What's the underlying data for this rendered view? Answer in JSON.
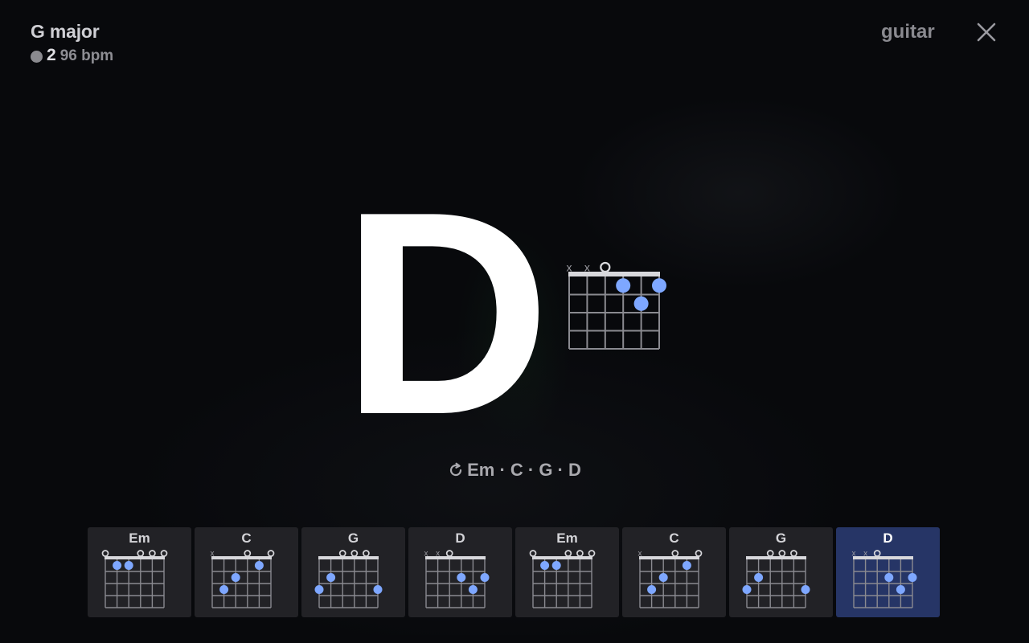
{
  "header": {
    "key": "G major",
    "beat": "2",
    "tempo": "96 bpm",
    "instrument": "guitar"
  },
  "current": {
    "chord": "D",
    "diagram": {
      "strings": [
        "x",
        "x",
        "o",
        "",
        "",
        ""
      ],
      "dots": [
        [
          4,
          1
        ],
        [
          6,
          1
        ],
        [
          5,
          2
        ]
      ]
    }
  },
  "progression": {
    "text": "Em · C · G · D",
    "icon": "loop-icon"
  },
  "strip": [
    {
      "chord": "Em",
      "strings": [
        "o",
        "",
        "",
        "o",
        "o",
        "o"
      ],
      "dots": [
        [
          2,
          1
        ],
        [
          3,
          1
        ]
      ]
    },
    {
      "chord": "C",
      "strings": [
        "x",
        "",
        "",
        "o",
        "",
        "o"
      ],
      "dots": [
        [
          2,
          3
        ],
        [
          3,
          2
        ],
        [
          5,
          1
        ]
      ]
    },
    {
      "chord": "G",
      "strings": [
        "",
        "",
        "o",
        "o",
        "o",
        ""
      ],
      "dots": [
        [
          1,
          3
        ],
        [
          2,
          2
        ],
        [
          6,
          3
        ]
      ]
    },
    {
      "chord": "D",
      "strings": [
        "x",
        "x",
        "o",
        "",
        "",
        ""
      ],
      "dots": [
        [
          4,
          2
        ],
        [
          6,
          2
        ],
        [
          5,
          3
        ]
      ]
    },
    {
      "chord": "Em",
      "strings": [
        "o",
        "",
        "",
        "o",
        "o",
        "o"
      ],
      "dots": [
        [
          2,
          1
        ],
        [
          3,
          1
        ]
      ]
    },
    {
      "chord": "C",
      "strings": [
        "x",
        "",
        "",
        "o",
        "",
        "o"
      ],
      "dots": [
        [
          2,
          3
        ],
        [
          3,
          2
        ],
        [
          5,
          1
        ]
      ]
    },
    {
      "chord": "G",
      "strings": [
        "",
        "",
        "o",
        "o",
        "o",
        ""
      ],
      "dots": [
        [
          1,
          3
        ],
        [
          2,
          2
        ],
        [
          6,
          3
        ]
      ]
    },
    {
      "chord": "D",
      "strings": [
        "x",
        "x",
        "o",
        "",
        "",
        ""
      ],
      "dots": [
        [
          4,
          2
        ],
        [
          6,
          2
        ],
        [
          5,
          3
        ]
      ],
      "active": true
    }
  ],
  "colors": {
    "dot": "#7ea7ff",
    "grid": "#8a8a90",
    "nut": "#d8d8dc",
    "active_tile": "#263566"
  }
}
